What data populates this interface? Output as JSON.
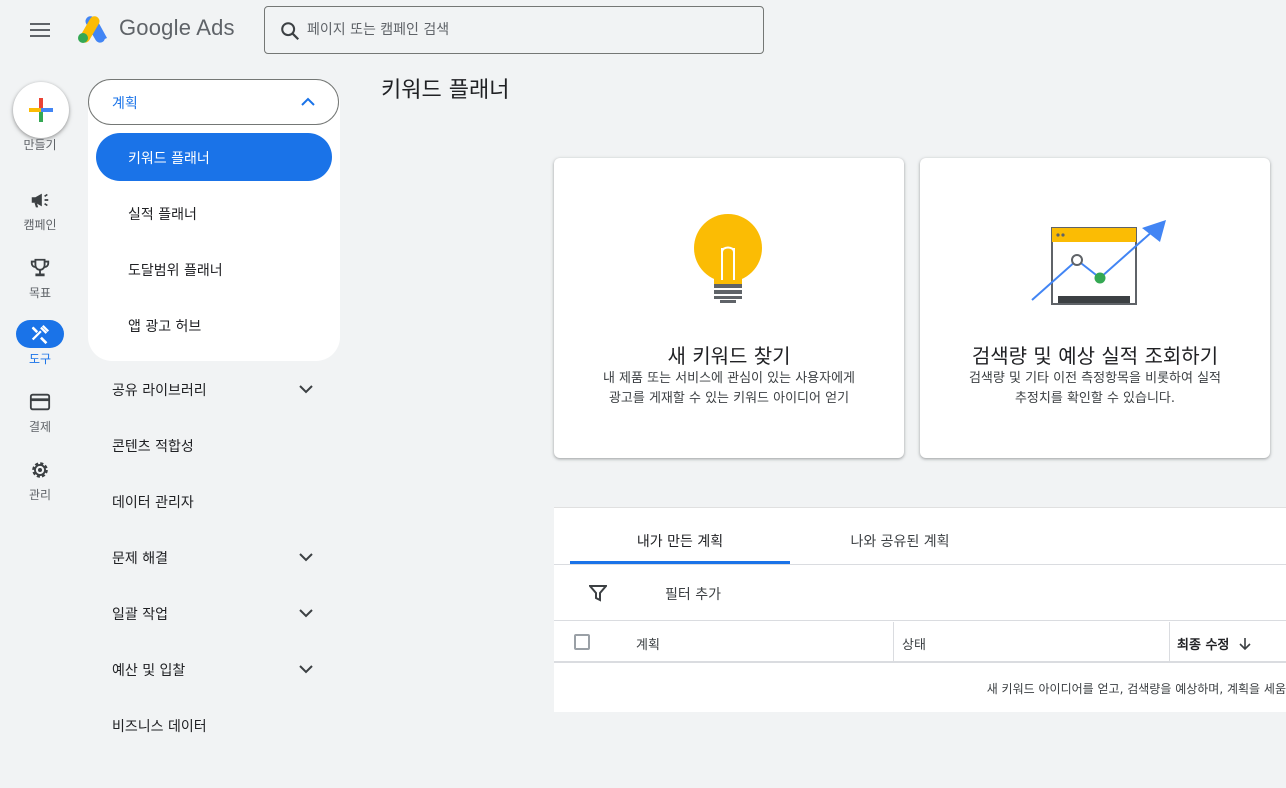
{
  "header": {
    "brand": "Google Ads",
    "search_placeholder": "페이지 또는 캠페인 검색"
  },
  "rail": {
    "create_label": "만들기",
    "items": [
      {
        "label": "캠페인",
        "icon": "megaphone-icon"
      },
      {
        "label": "목표",
        "icon": "trophy-icon"
      },
      {
        "label": "도구",
        "icon": "tools-icon",
        "active": true
      },
      {
        "label": "결제",
        "icon": "credit-card-icon"
      },
      {
        "label": "관리",
        "icon": "gear-icon"
      }
    ]
  },
  "subnav": {
    "group_title": "계획",
    "group_items": [
      "키워드 플래너",
      "실적 플래너",
      "도달범위 플래너",
      "앱 광고 허브"
    ],
    "items": [
      {
        "label": "공유 라이브러리",
        "expandable": true
      },
      {
        "label": "콘텐츠 적합성",
        "expandable": false
      },
      {
        "label": "데이터 관리자",
        "expandable": false
      },
      {
        "label": "문제 해결",
        "expandable": true
      },
      {
        "label": "일괄 작업",
        "expandable": true
      },
      {
        "label": "예산 및 입찰",
        "expandable": true
      },
      {
        "label": "비즈니스 데이터",
        "expandable": false
      }
    ]
  },
  "main": {
    "title": "키워드 플래너",
    "cards": [
      {
        "title": "새 키워드 찾기",
        "desc1": "내 제품 또는 서비스에 관심이 있는 사용자에게",
        "desc2": "광고를 게재할 수 있는 키워드 아이디어 얻기"
      },
      {
        "title": "검색량 및 예상 실적 조회하기",
        "desc1": "검색량 및 기타 이전 측정항목을 비롯하여 실적",
        "desc2": "추정치를 확인할 수 있습니다."
      }
    ],
    "tabs": [
      "내가 만든 계획",
      "나와 공유된 계획"
    ],
    "filter_label": "필터 추가",
    "columns": [
      "계획",
      "상태",
      "최종 수정"
    ],
    "empty_text": "새 키워드 아이디어를 얻고, 검색량을 예상하며, 계획을 세움"
  },
  "colors": {
    "accent": "#1a73e8",
    "background": "#f1f3f4",
    "bulb": "#fbbc04",
    "green_point": "#34a853"
  }
}
